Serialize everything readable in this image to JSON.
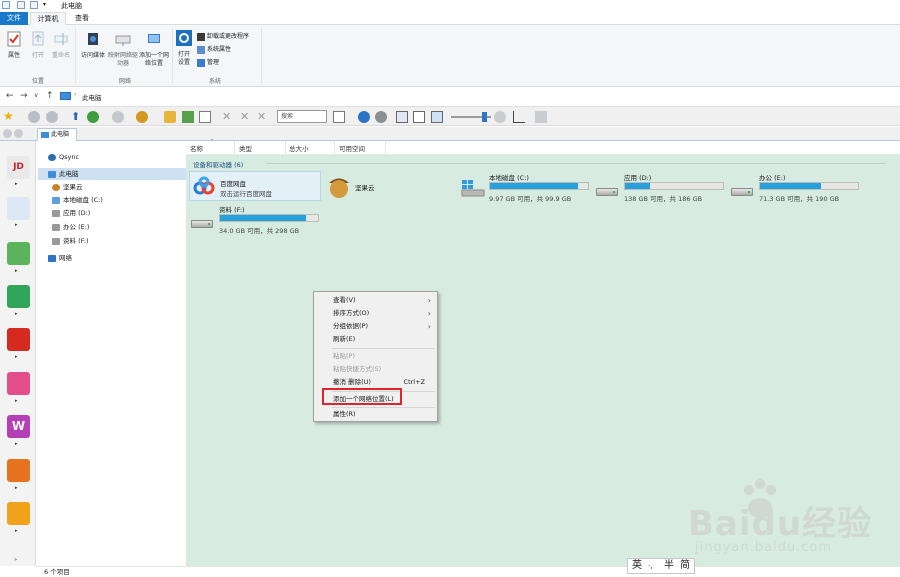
{
  "window": {
    "title": "此电脑",
    "ribbon_tabs": [
      "文件",
      "计算机",
      "查看"
    ]
  },
  "ribbon": {
    "location_group": {
      "label": "位置",
      "buttons": [
        "属性",
        "打开",
        "重命名"
      ]
    },
    "network_group": {
      "label": "网络",
      "buttons": [
        "访问媒体",
        "映射网络驱动器",
        "添加一个网络位置"
      ]
    },
    "system_group": {
      "label": "系统",
      "open_settings": "打开设置",
      "small_items": [
        "卸载或更改程序",
        "系统属性",
        "管理"
      ]
    }
  },
  "addressbar": {
    "path": "此电脑"
  },
  "toolbar": {
    "search_placeholder": "搜索"
  },
  "tabstrip": {
    "tab_label": "此电脑"
  },
  "navpane": {
    "items": [
      "Qsync",
      "此电脑",
      "坚果云",
      "本地磁盘 (C:)",
      "应用 (D:)",
      "办公 (E:)",
      "资料 (F:)",
      "网络"
    ]
  },
  "columns": [
    "名称",
    "类型",
    "总大小",
    "可用空间"
  ],
  "content": {
    "group_label": "设备和驱动器 (6)",
    "apps": [
      {
        "name": "百度网盘",
        "sub": "双击运行百度网盘"
      },
      {
        "name": "坚果云",
        "sub": ""
      }
    ],
    "drives": [
      {
        "name": "本地磁盘 (C:)",
        "info": "9.97 GB 可用，共 99.9 GB",
        "used_fraction": 0.9
      },
      {
        "name": "应用 (D:)",
        "info": "138 GB 可用，共 186 GB",
        "used_fraction": 0.26
      },
      {
        "name": "办公 (E:)",
        "info": "71.3 GB 可用，共 190 GB",
        "used_fraction": 0.62
      },
      {
        "name": "资料 (F:)",
        "info": "34.0 GB 可用，共 298 GB",
        "used_fraction": 0.88
      }
    ]
  },
  "context_menu": {
    "items": [
      {
        "label": "查看(V)",
        "submenu": true
      },
      {
        "label": "排序方式(O)",
        "submenu": true
      },
      {
        "label": "分组依据(P)",
        "submenu": true
      },
      {
        "label": "刷新(E)"
      },
      {
        "label": "粘贴(P)",
        "disabled": true
      },
      {
        "label": "粘贴快捷方式(S)",
        "disabled": true
      },
      {
        "label": "撤消 删除(U)",
        "shortcut": "Ctrl+Z"
      },
      {
        "label": "添加一个网络位置(L)",
        "highlighted": true
      },
      {
        "label": "属性(R)"
      }
    ]
  },
  "statusbar": {
    "text": "6 个项目"
  },
  "ime": {
    "lang": "英",
    "punct": "·,",
    "width": "半",
    "script": "简"
  },
  "watermark": {
    "brand": "Baidu经验",
    "url": "jingyan.baidu.com"
  },
  "colors": {
    "file_tab": "#1979ca",
    "content_bg": "#d7ebe0",
    "drive_bar": "#26a0da",
    "highlight_box": "#e0242c"
  }
}
